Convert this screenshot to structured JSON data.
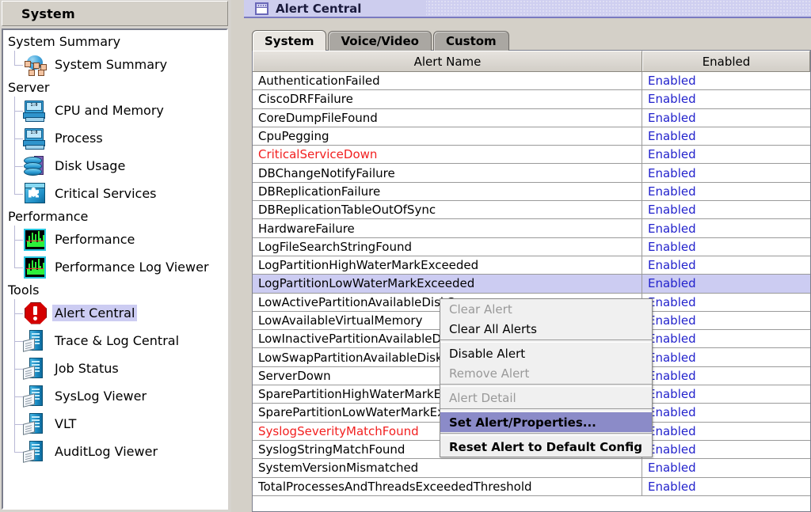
{
  "left_panel": {
    "header_title": "System",
    "tree": [
      {
        "type": "group",
        "label": "System Summary"
      },
      {
        "type": "item",
        "label": "System Summary",
        "icon": "globe-network-icon",
        "selected": false
      },
      {
        "type": "group",
        "label": "Server"
      },
      {
        "type": "item",
        "label": "CPU and Memory",
        "icon": "server-monitor-icon",
        "selected": false
      },
      {
        "type": "item",
        "label": "Process",
        "icon": "server-monitor-icon",
        "selected": false
      },
      {
        "type": "item",
        "label": "Disk Usage",
        "icon": "disk-stack-icon",
        "selected": false
      },
      {
        "type": "item",
        "label": "Critical Services",
        "icon": "puzzle-cube-icon",
        "selected": false
      },
      {
        "type": "group",
        "label": "Performance"
      },
      {
        "type": "item",
        "label": "Performance",
        "icon": "performance-graph-icon",
        "selected": false
      },
      {
        "type": "item",
        "label": "Performance Log Viewer",
        "icon": "performance-graph-icon",
        "selected": false
      },
      {
        "type": "group",
        "label": "Tools"
      },
      {
        "type": "item",
        "label": "Alert Central",
        "icon": "alert-octagon-icon",
        "selected": true
      },
      {
        "type": "item",
        "label": "Trace & Log Central",
        "icon": "log-server-icon",
        "selected": false
      },
      {
        "type": "item",
        "label": "Job Status",
        "icon": "log-server-icon",
        "selected": false
      },
      {
        "type": "item",
        "label": "SysLog Viewer",
        "icon": "log-server-icon",
        "selected": false
      },
      {
        "type": "item",
        "label": "VLT",
        "icon": "log-server-icon",
        "selected": false
      },
      {
        "type": "item",
        "label": "AuditLog Viewer",
        "icon": "log-server-icon",
        "selected": false
      }
    ]
  },
  "divider": {
    "collapse_icon": "left-triangle-icon"
  },
  "right_panel": {
    "window_title": "Alert Central",
    "window_icon": "document-window-icon",
    "tabs": [
      {
        "label": "System",
        "selected": true
      },
      {
        "label": "Voice/Video",
        "selected": false
      },
      {
        "label": "Custom",
        "selected": false
      }
    ],
    "table": {
      "columns": [
        "Alert Name",
        "Enabled"
      ],
      "rows": [
        {
          "name": "AuthenticationFailed",
          "enabled": "Enabled",
          "critical": false,
          "selected": false
        },
        {
          "name": "CiscoDRFFailure",
          "enabled": "Enabled",
          "critical": false,
          "selected": false
        },
        {
          "name": "CoreDumpFileFound",
          "enabled": "Enabled",
          "critical": false,
          "selected": false
        },
        {
          "name": "CpuPegging",
          "enabled": "Enabled",
          "critical": false,
          "selected": false
        },
        {
          "name": "CriticalServiceDown",
          "enabled": "Enabled",
          "critical": true,
          "selected": false
        },
        {
          "name": "DBChangeNotifyFailure",
          "enabled": "Enabled",
          "critical": false,
          "selected": false
        },
        {
          "name": "DBReplicationFailure",
          "enabled": "Enabled",
          "critical": false,
          "selected": false
        },
        {
          "name": "DBReplicationTableOutOfSync",
          "enabled": "Enabled",
          "critical": false,
          "selected": false
        },
        {
          "name": "HardwareFailure",
          "enabled": "Enabled",
          "critical": false,
          "selected": false
        },
        {
          "name": "LogFileSearchStringFound",
          "enabled": "Enabled",
          "critical": false,
          "selected": false
        },
        {
          "name": "LogPartitionHighWaterMarkExceeded",
          "enabled": "Enabled",
          "critical": false,
          "selected": false
        },
        {
          "name": "LogPartitionLowWaterMarkExceeded",
          "enabled": "Enabled",
          "critical": false,
          "selected": true
        },
        {
          "name": "LowActivePartitionAvailableDiskSpace",
          "enabled": "Enabled",
          "critical": false,
          "selected": false
        },
        {
          "name": "LowAvailableVirtualMemory",
          "enabled": "Enabled",
          "critical": false,
          "selected": false
        },
        {
          "name": "LowInactivePartitionAvailableDiskSpace",
          "enabled": "Enabled",
          "critical": false,
          "selected": false
        },
        {
          "name": "LowSwapPartitionAvailableDiskSpace",
          "enabled": "Enabled",
          "critical": false,
          "selected": false
        },
        {
          "name": "ServerDown",
          "enabled": "Enabled",
          "critical": false,
          "selected": false
        },
        {
          "name": "SparePartitionHighWaterMarkExceeded",
          "enabled": "Enabled",
          "critical": false,
          "selected": false
        },
        {
          "name": "SparePartitionLowWaterMarkExceeded",
          "enabled": "Enabled",
          "critical": false,
          "selected": false
        },
        {
          "name": "SyslogSeverityMatchFound",
          "enabled": "Enabled",
          "critical": true,
          "selected": false
        },
        {
          "name": "SyslogStringMatchFound",
          "enabled": "Enabled",
          "critical": false,
          "selected": false
        },
        {
          "name": "SystemVersionMismatched",
          "enabled": "Enabled",
          "critical": false,
          "selected": false
        },
        {
          "name": "TotalProcessesAndThreadsExceededThreshold",
          "enabled": "Enabled",
          "critical": false,
          "selected": false
        }
      ]
    }
  },
  "context_menu": {
    "items": [
      {
        "label": "Clear Alert",
        "state": "disabled"
      },
      {
        "label": "Clear All Alerts",
        "state": "normal"
      },
      {
        "label": "",
        "state": "separator"
      },
      {
        "label": "Disable Alert",
        "state": "normal"
      },
      {
        "label": "Remove Alert",
        "state": "disabled"
      },
      {
        "label": "",
        "state": "separator"
      },
      {
        "label": "Alert Detail",
        "state": "disabled"
      },
      {
        "label": "",
        "state": "separator"
      },
      {
        "label": "Set Alert/Properties...",
        "state": "highlighted"
      },
      {
        "label": "",
        "state": "separator"
      },
      {
        "label": "Reset Alert to Default Config",
        "state": "bold"
      }
    ]
  },
  "colors": {
    "selection": "#ccccf2",
    "critical_text": "#f22020",
    "link_text": "#2222cc",
    "titlebar": "#cdcdee",
    "menu_highlight": "#8b8bc8",
    "panel_face": "#d4d0c8"
  }
}
